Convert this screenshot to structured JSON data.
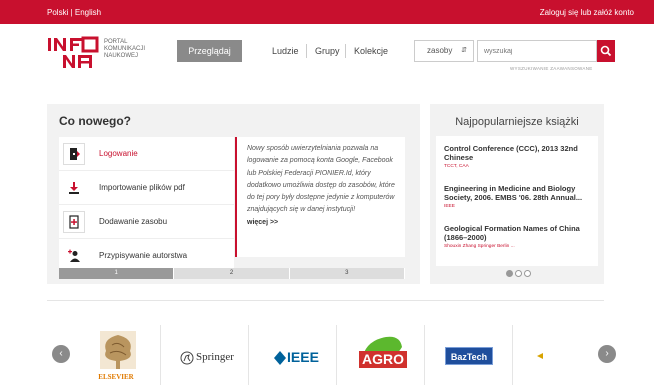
{
  "topbar": {
    "lang_polish": "Polski",
    "lang_sep": " | ",
    "lang_english": "English",
    "login": "Zaloguj się lub załóż konto"
  },
  "header": {
    "logo_line1": "PORTAL",
    "logo_line2": "KOMUNIKACJI",
    "logo_line3": "NAUKOWEJ",
    "browse_button": "Przeglądaj",
    "nav": [
      "Ludzie",
      "Grupy",
      "Kolekcje"
    ],
    "search_scope": "zasoby",
    "search_placeholder": "wyszukaj",
    "advanced_search": "WYSZUKIWANIE ZAAWANSOWANE"
  },
  "whats_new": {
    "title": "Co nowego?",
    "items": [
      {
        "label": "Logowanie",
        "icon": "login-door-icon"
      },
      {
        "label": "Importowanie plików pdf",
        "icon": "download-arrow-icon"
      },
      {
        "label": "Dodawanie zasobu",
        "icon": "add-file-icon"
      },
      {
        "label": "Przypisywanie autorstwa",
        "icon": "add-person-icon"
      }
    ],
    "description": "Nowy sposób uwierzytelniania pozwala na logowanie za pomocą konta Google, Facebook lub Polskiej Federacji PIONIER.Id, który dodatkowo umożliwia dostęp do zasobów, które do tej pory były dostępne jedynie z komputerów znajdujących się w danej instytucji!",
    "more": "więcej >>",
    "pages": [
      "1",
      "2",
      "3"
    ]
  },
  "popular_books": {
    "title": "Najpopularniejsze książki",
    "books": [
      {
        "title": "Control Conference (CCC), 2013 32nd Chinese",
        "author": "TCCT, CAA"
      },
      {
        "title": "Engineering in Medicine and Biology Society, 2006. EMBS '06. 28th Annual...",
        "author": "IEEE"
      },
      {
        "title": "Geological Formation Names of China (1866–2000)",
        "author": "Shouxin Zhang Springer Berlin ..."
      }
    ]
  },
  "publishers": [
    "ELSEVIER",
    "Springer",
    "IEEE",
    "AGRO",
    "BazTech"
  ],
  "colors": {
    "accent": "#c8102e",
    "gray_button": "#8a8a8a",
    "panel_bg": "#f2f2f2"
  }
}
